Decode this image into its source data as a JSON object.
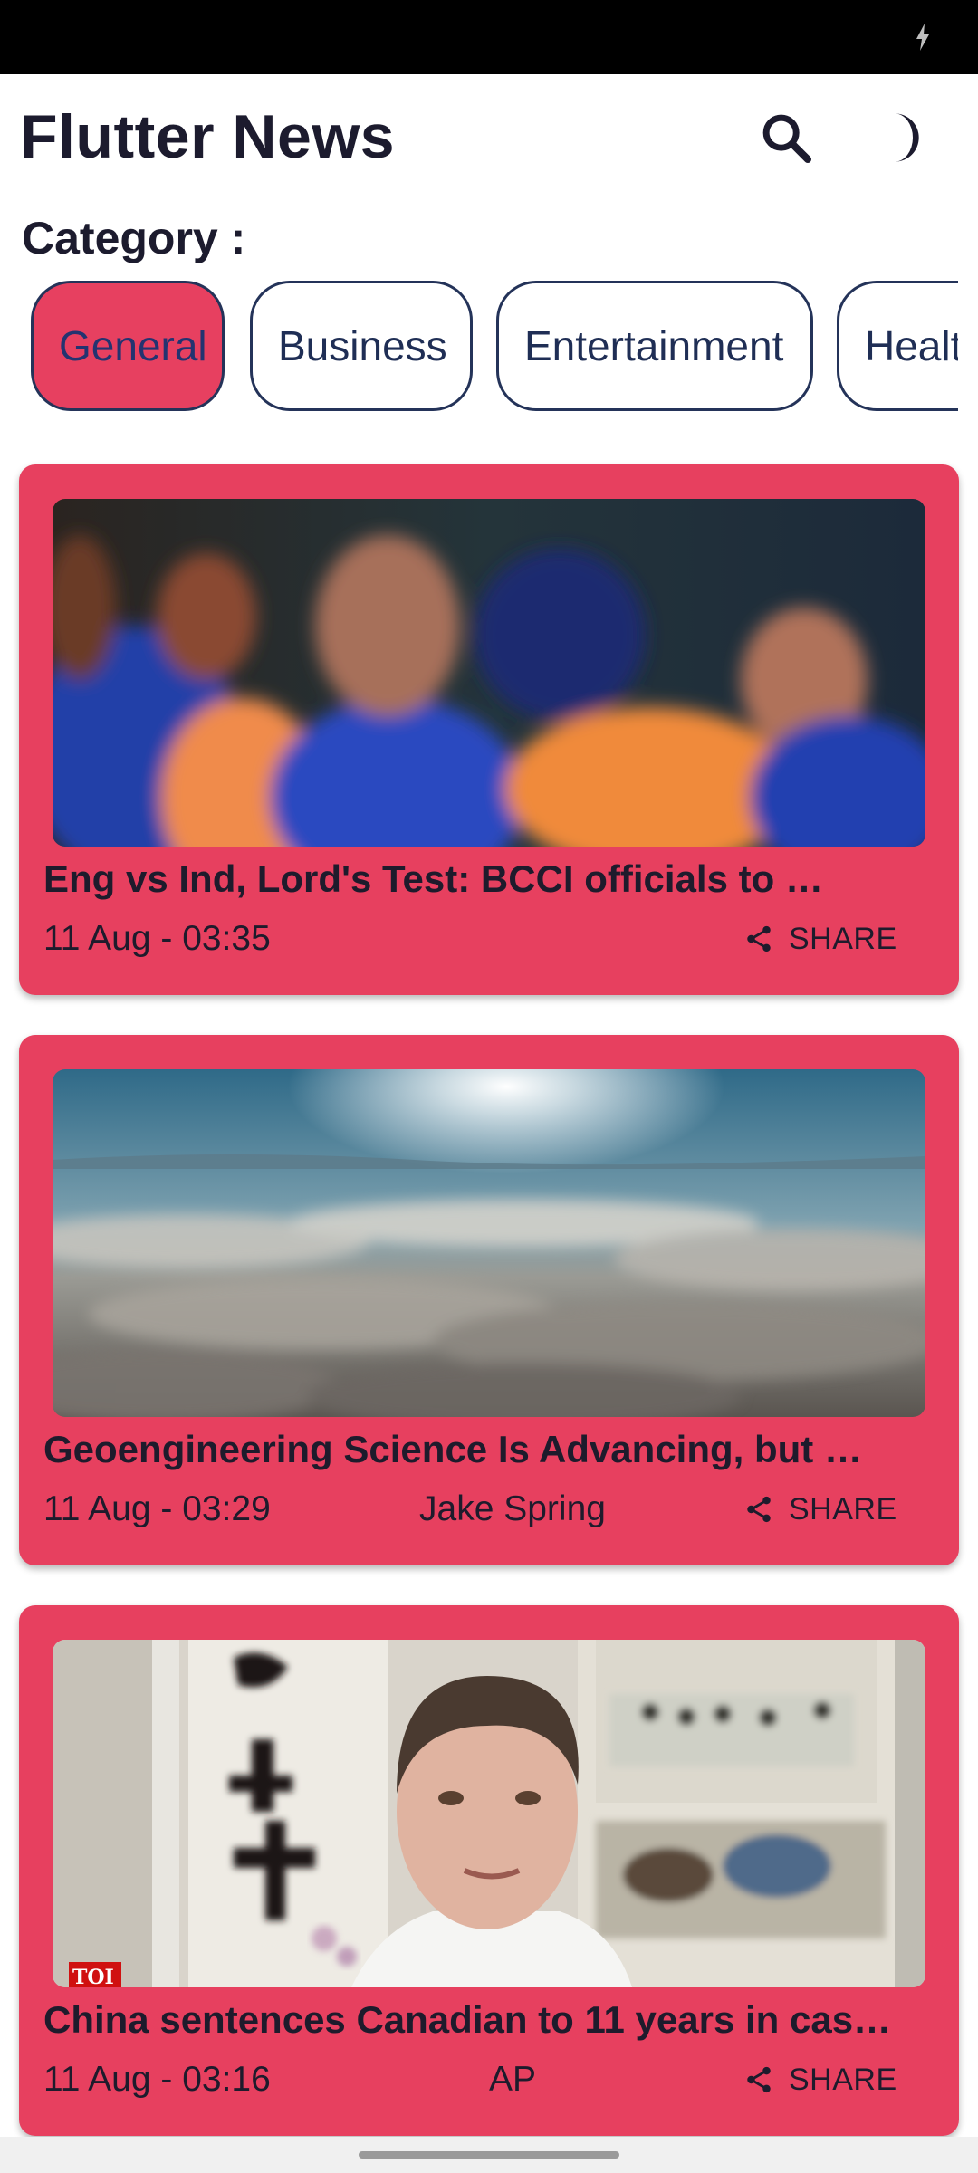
{
  "app": {
    "title": "Flutter News"
  },
  "icons": {
    "search": "search-icon",
    "theme": "moon-icon",
    "share": "share-icon",
    "charging": "charging-icon"
  },
  "colors": {
    "accent": "#e7405f",
    "chip_border": "#243359",
    "text": "#1c1b2e"
  },
  "category": {
    "label": "Category :",
    "chips": [
      {
        "label": "General",
        "selected": true
      },
      {
        "label": "Business",
        "selected": false
      },
      {
        "label": "Entertainment",
        "selected": false
      },
      {
        "label": "Healt",
        "selected": false
      }
    ]
  },
  "articles": [
    {
      "title": "Eng vs Ind, Lord's Test: BCCI officials to …",
      "date": "11 Aug - 03:35",
      "source": "",
      "share_label": "SHARE"
    },
    {
      "title": "Geoengineering Science Is Advancing, but …",
      "date": "11 Aug - 03:29",
      "source": "Jake Spring",
      "share_label": "SHARE"
    },
    {
      "title": "China sentences Canadian to 11 years in cas…",
      "date": "11 Aug - 03:16",
      "source": "AP",
      "share_label": "SHARE"
    }
  ]
}
